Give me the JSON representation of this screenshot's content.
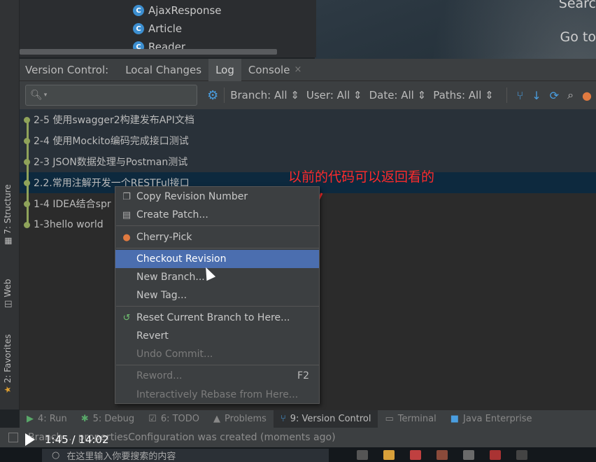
{
  "tree": {
    "items": [
      {
        "icon": "C",
        "label": "AjaxResponse"
      },
      {
        "icon": "C",
        "label": "Article"
      },
      {
        "icon": "C",
        "label": "Reader"
      }
    ]
  },
  "welcome": {
    "search": "Searc",
    "goto": "Go to"
  },
  "left_stripe": {
    "structure": "7: Structure",
    "web": "Web",
    "favorites": "2: Favorites"
  },
  "vc": {
    "title": "Version Control:",
    "tabs": [
      {
        "label": "Local Changes"
      },
      {
        "label": "Log",
        "active": true
      },
      {
        "label": "Console",
        "closable": true
      }
    ],
    "close_glyph": "×"
  },
  "toolbar": {
    "search_placeholder": "",
    "filters": [
      {
        "label": "Branch: All"
      },
      {
        "label": "User: All"
      },
      {
        "label": "Date: All"
      },
      {
        "label": "Paths: All"
      }
    ]
  },
  "commits": [
    {
      "message": "2-5 使用swagger2构建发布API文档"
    },
    {
      "message": "2-4 使用Mockito编码完成接口测试"
    },
    {
      "message": "2-3 JSON数据处理与Postman测试"
    },
    {
      "message": "2.2.常用注解开发一个RESTFul接口"
    },
    {
      "message": "1-4 IDEA结合spr"
    },
    {
      "message": "1-3hello world"
    }
  ],
  "menu": {
    "items": [
      {
        "label": "Copy Revision Number",
        "icon": "copy-icon"
      },
      {
        "label": "Create Patch...",
        "icon": "patch-icon"
      },
      {
        "label": "Cherry-Pick",
        "icon": "cherry-icon"
      },
      {
        "label": "Checkout Revision",
        "highlighted": true
      },
      {
        "label": "New Branch..."
      },
      {
        "label": "New Tag..."
      },
      {
        "label": "Reset Current Branch to Here...",
        "icon": "reset-icon"
      },
      {
        "label": "Revert"
      },
      {
        "label": "Undo Commit...",
        "disabled": true
      },
      {
        "label": "Reword...",
        "shortcut": "F2",
        "disabled": true
      },
      {
        "label": "Interactively Rebase from Here...",
        "disabled": true
      }
    ]
  },
  "annotation": "以前的代码可以返回看的",
  "tool_windows": [
    {
      "label": "4: Run",
      "icon": "run-icon"
    },
    {
      "label": "5: Debug",
      "icon": "debug-icon"
    },
    {
      "label": "6: TODO",
      "icon": "todo-icon"
    },
    {
      "label": "Problems",
      "icon": "problems-icon"
    },
    {
      "label": "9: Version Control",
      "icon": "vcs-icon",
      "active": true
    },
    {
      "label": "Terminal",
      "icon": "terminal-icon"
    },
    {
      "label": "Java Enterprise",
      "icon": "javaee-icon"
    }
  ],
  "status": {
    "message": "Branch ... propertiesConfiguration was created (moments ago)"
  },
  "player": {
    "time": "1:45 / 14:02"
  },
  "taskbar": {
    "search_placeholder": "在这里输入你要搜索的内容"
  },
  "colors": {
    "highlight": "#4b6eaf",
    "selected_row": "#0d293e",
    "graph": "#8fa35a",
    "annotation": "#ff2b2b"
  }
}
